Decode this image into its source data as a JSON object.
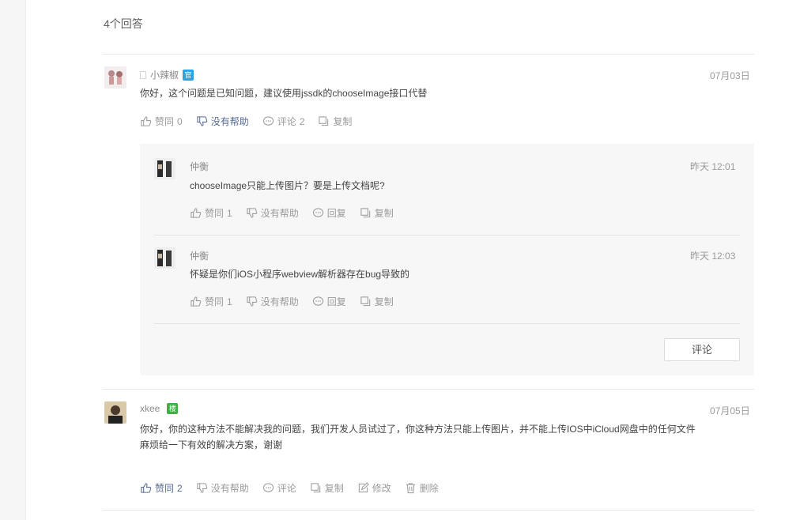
{
  "answers_count": "4个回答",
  "answers": [
    {
      "user": "小辣椒",
      "badge": "官",
      "date": "07月03日",
      "content": "你好，这个问题是已知问题，建议使用jssdk的chooseImage接口代替",
      "actions": {
        "agree_label": "赞同",
        "agree_count": "0",
        "unhelpful_label": "没有帮助",
        "comment_label": "评论",
        "comment_count": "2",
        "copy_label": "复制"
      },
      "comments": [
        {
          "user": "仲衡",
          "date": "昨天 12:01",
          "content": "chooseImage只能上传图片？要是上传文档呢?",
          "agree_label": "赞同",
          "agree_count": "1",
          "unhelpful_label": "没有帮助",
          "reply_label": "回复",
          "copy_label": "复制"
        },
        {
          "user": "仲衡",
          "date": "昨天 12:03",
          "content": "怀疑是你们iOS小程序webview解析器存在bug导致的",
          "agree_label": "赞同",
          "agree_count": "1",
          "unhelpful_label": "没有帮助",
          "reply_label": "回复",
          "copy_label": "复制"
        }
      ],
      "comment_button": "评论"
    },
    {
      "user": "xkee",
      "badge": "楼",
      "date": "07月05日",
      "content_line1": "你好，你的这种方法不能解决我的问题，我们开发人员试过了，你这种方法只能上传图片，并不能上传IOS中iCloud网盘中的任何文件",
      "content_line2": "麻烦给一下有效的解决方案，谢谢",
      "actions": {
        "agree_label": "赞同",
        "agree_count": "2",
        "unhelpful_label": "没有帮助",
        "comment_label": "评论",
        "copy_label": "复制",
        "edit_label": "修改",
        "delete_label": "删除"
      }
    }
  ],
  "colors": {
    "link_blue": "#576b95",
    "official_badge": "#2ba3e0",
    "floor_badge": "#3cb043"
  }
}
